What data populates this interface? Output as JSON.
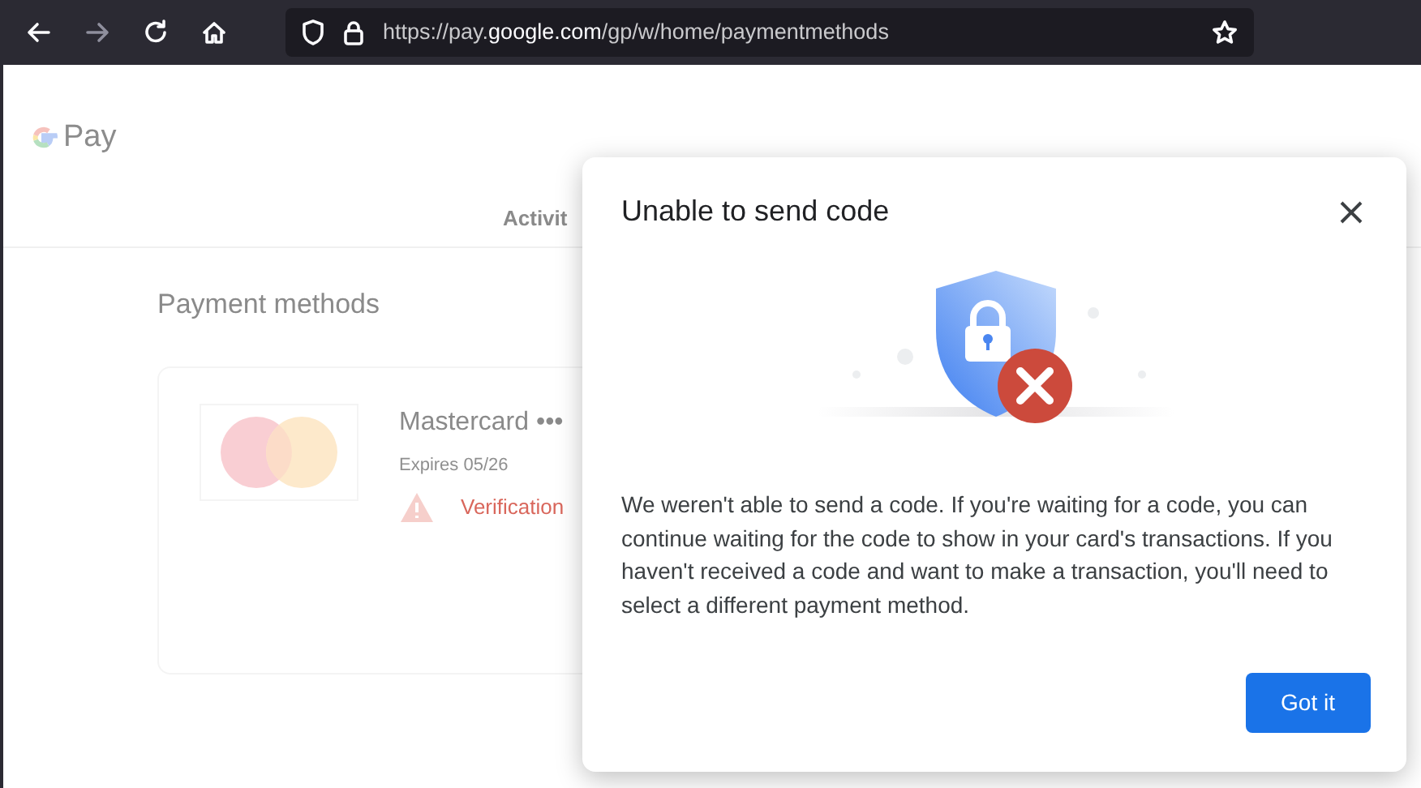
{
  "browser": {
    "url_host": "https://pay.",
    "url_domain": "google.com",
    "url_path": "/gp/w/home/paymentmethods",
    "forward_disabled": true
  },
  "page": {
    "logo": "Pay",
    "tabs": [
      {
        "label": "Activit"
      }
    ],
    "heading": "Payment methods",
    "card": {
      "name": "Mastercard •••",
      "expires": "Expires 05/26",
      "warning": "Verification"
    }
  },
  "dialog": {
    "title": "Unable to send code",
    "body": "We weren't able to send a code. If you're waiting for a code, you can continue waiting for the code to show in your card's transactions. If you haven't received a code and want to make a transaction, you'll need to select a different payment method.",
    "button": "Got it"
  }
}
